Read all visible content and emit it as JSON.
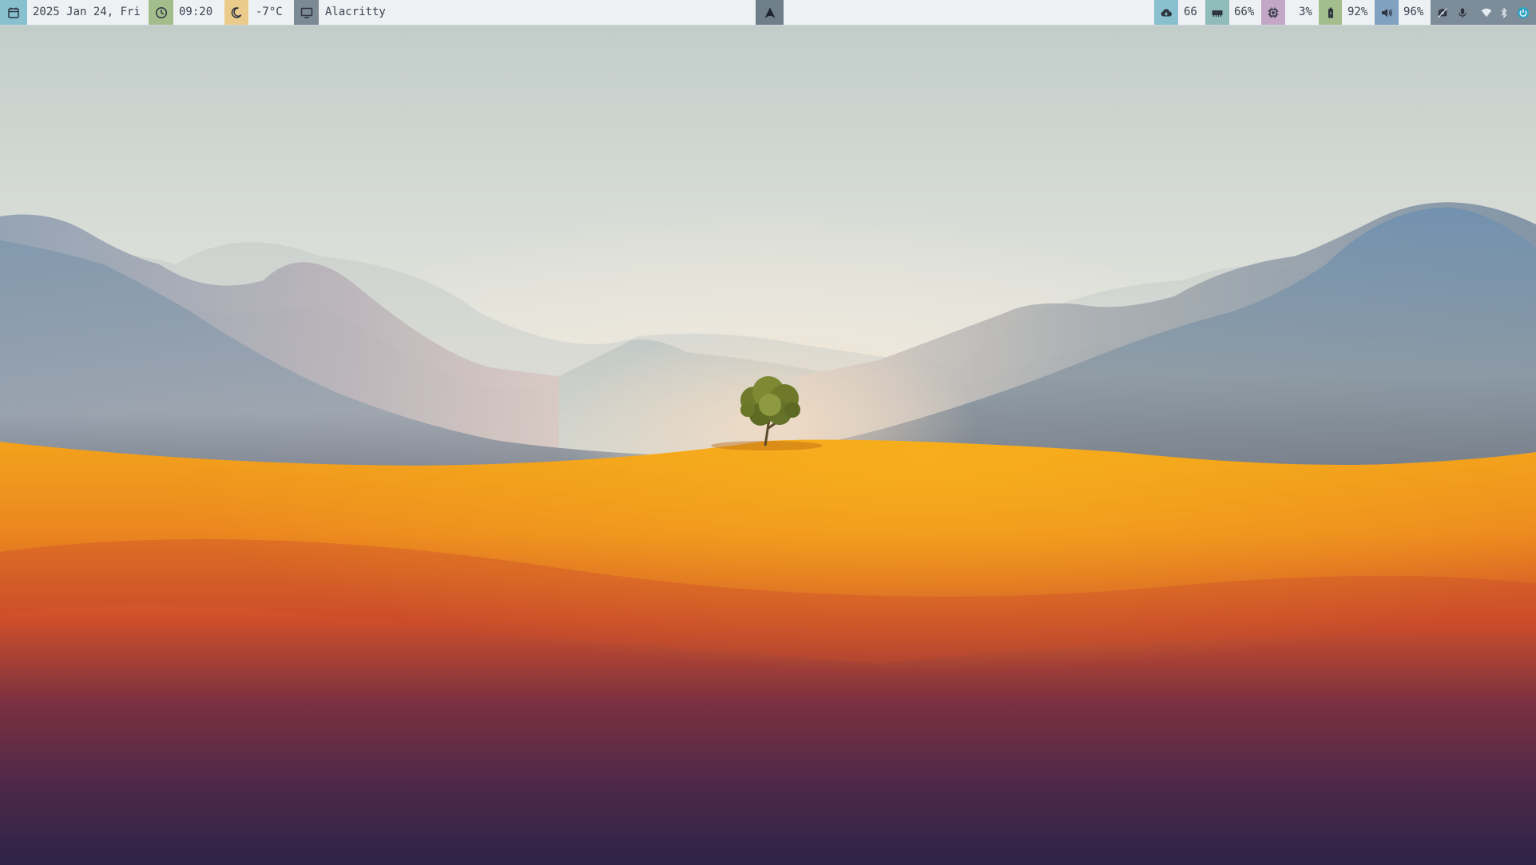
{
  "statusbar": {
    "date": "2025 Jan 24, Fri",
    "time": "09:20",
    "weather": "-7°C",
    "window_title": "Alacritty",
    "cloud_value": "66",
    "memory": "66%",
    "cpu": "3%",
    "battery": "92%",
    "volume": "96%",
    "icons": {
      "date": "calendar-icon",
      "time": "clock-icon",
      "weather": "moon-icon",
      "window": "monitor-icon",
      "launcher": "arch-logo-icon",
      "cloud": "cloud-download-icon",
      "memory": "memory-chip-icon",
      "cpu": "cpu-icon",
      "battery": "battery-icon",
      "volume": "speaker-icon",
      "privacy": "camera-off-icon",
      "mic": "microphone-icon",
      "wifi": "wifi-icon",
      "bluetooth": "bluetooth-icon",
      "power": "power-icon"
    }
  },
  "colors": {
    "bar_bg": "#eef1f3",
    "date_block": "#88c0d0",
    "time_block": "#a3be8c",
    "weather_block": "#ebcb8b",
    "window_block": "#7b8a95",
    "launcher_block": "#6e7f8a",
    "cloud_block": "#88c0d0",
    "memory_block": "#8fbcbb",
    "cpu_block": "#c4a7c6",
    "battery_block": "#a3be8c",
    "volume_block": "#81a1c1"
  }
}
